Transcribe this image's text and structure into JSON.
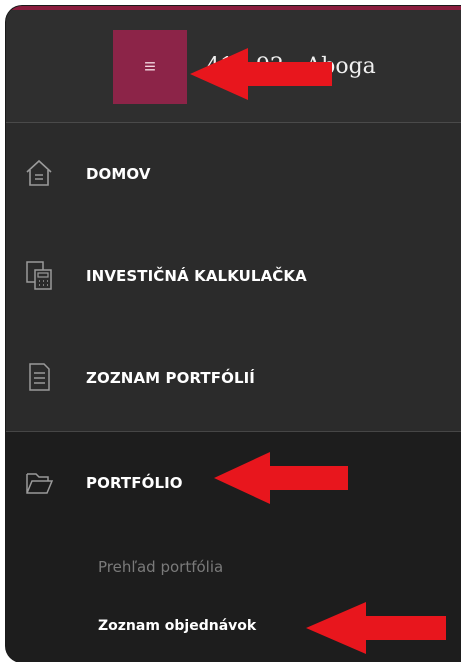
{
  "header": {
    "menu_icon": "hamburger-icon",
    "title": "41     92 - Aboga"
  },
  "nav": {
    "items": [
      {
        "label": "DOMOV",
        "icon": "home-icon"
      },
      {
        "label": "INVESTIČNÁ KALKULAČKA",
        "icon": "calculator-icon"
      },
      {
        "label": "ZOZNAM PORTFÓLIÍ",
        "icon": "document-icon"
      },
      {
        "label": "PORTFÓLIO",
        "icon": "folder-open-icon"
      }
    ],
    "submenu": [
      {
        "label": "Prehľad portfólia"
      },
      {
        "label": "Zoznam objednávok"
      }
    ]
  },
  "colors": {
    "accent": "#8c2448",
    "sidebar_bg": "#2b2b2b",
    "submenu_bg": "#1d1d1d",
    "annotation_arrow": "#e8161d"
  }
}
